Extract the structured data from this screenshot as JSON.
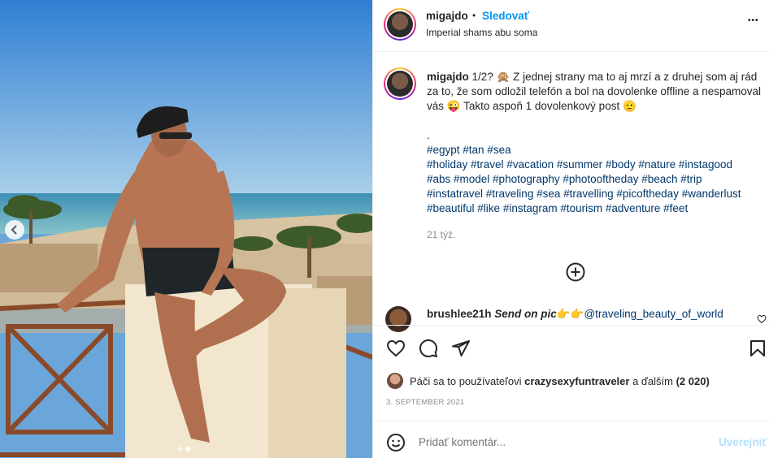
{
  "post": {
    "username": "migajdo",
    "follow_label": "Sledovať",
    "dot": "•",
    "location": "Imperial shams abu soma",
    "more_label": "•••"
  },
  "caption": {
    "username": "migajdo",
    "text": "1/2? 🙊 Z jednej strany ma to aj mrzí a z druhej som aj rád za to, že som odložil telefón a bol na dovolenke offline a nespamoval vás 😜 Takto aspoň 1 dovolenkový post 🫡",
    "dot_line": ".",
    "hashtag_lines": [
      "#egypt #tan #sea",
      "#holiday #travel #vacation #summer #body #nature #instagood",
      "#abs #model #photography #photooftheday #beach #trip",
      "#instatravel #traveling #sea #travelling #picoftheday #wanderlust",
      "#beautiful #like #instagram #tourism #adventure #feet"
    ],
    "time": "21 týž."
  },
  "comment": {
    "username": "brushlee21h",
    "text_italic": "Send on pic",
    "emoji": "👉👉",
    "mention": "@traveling_beauty_of_world"
  },
  "likes": {
    "prefix": "Páči sa to používateľovi ",
    "user": "crazysexyfuntraveler",
    "middle": " a ďalším ",
    "count": "(2 020)"
  },
  "date": "3. SEPTEMBER 2021",
  "comment_input": {
    "placeholder": "Pridať komentár...",
    "publish_label": "Uverejniť"
  },
  "colors": {
    "accent": "#0095f6",
    "hashtag": "#00376b",
    "muted": "#8e8e8e"
  }
}
